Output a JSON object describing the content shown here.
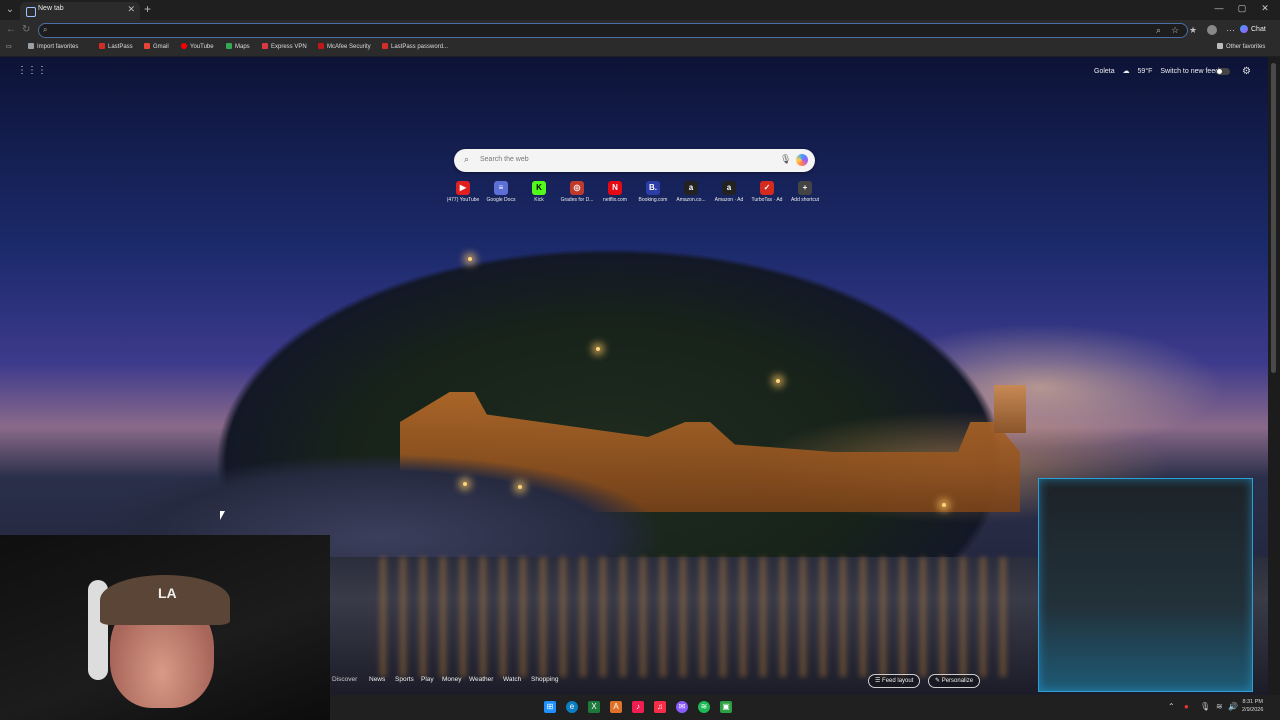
{
  "browser": {
    "tab_title": "New tab",
    "new_tab_symbol": "+",
    "address_placeholder": "",
    "chat_label": "Chat",
    "bookmarks": [
      {
        "label": "Import favorites",
        "color": "#9aa0a6",
        "icon": "import-icon"
      },
      {
        "label": "LastPass",
        "color": "#d32d27",
        "icon": "lastpass-icon"
      },
      {
        "label": "Gmail",
        "color": "#ea4335",
        "icon": "gmail-icon"
      },
      {
        "label": "YouTube",
        "color": "#ff0000",
        "icon": "youtube-icon"
      },
      {
        "label": "Maps",
        "color": "#34a853",
        "icon": "maps-icon"
      },
      {
        "label": "Express VPN",
        "color": "#da3940",
        "icon": "expressvpn-icon"
      },
      {
        "label": "McAfee Security",
        "color": "#c01818",
        "icon": "mcafee-icon"
      },
      {
        "label": "LastPass password...",
        "color": "#d32d27",
        "icon": "lastpass-icon"
      }
    ],
    "other_favorites": "Other favorites"
  },
  "ntp": {
    "weather": {
      "location": "Goleta",
      "temp": "59°F"
    },
    "switch_feed": "Switch to new feed",
    "search_placeholder": "Search the web",
    "shortcuts": [
      {
        "label": "(477) YouTube",
        "glyph": "▶",
        "color": "#e02020"
      },
      {
        "label": "Google Docs",
        "glyph": "≡",
        "color": "#5b6fd6"
      },
      {
        "label": "Kick",
        "glyph": "K",
        "color": "#53fc18"
      },
      {
        "label": "Grades for D...",
        "glyph": "◎",
        "color": "#c0392b"
      },
      {
        "label": "netflix.com",
        "glyph": "N",
        "color": "#e50914"
      },
      {
        "label": "Booking.com",
        "glyph": "B.",
        "color": "#2b3ea8"
      },
      {
        "label": "Amazon.co...",
        "glyph": "a",
        "color": "#222222"
      },
      {
        "label": "Amazon · Ad",
        "glyph": "a",
        "color": "#222222"
      },
      {
        "label": "TurboTax · Ad",
        "glyph": "✓",
        "color": "#d52b1e"
      },
      {
        "label": "Add shortcut",
        "glyph": "+",
        "color": "#444444"
      }
    ],
    "feed_tabs": [
      "Discover",
      "News",
      "Sports",
      "Play",
      "Money",
      "Weather",
      "Watch",
      "Shopping"
    ],
    "feed_layout": "Feed layout",
    "personalize": "Personalize"
  },
  "taskbar": {
    "time": "8:31 PM",
    "date": "2/9/2026"
  }
}
